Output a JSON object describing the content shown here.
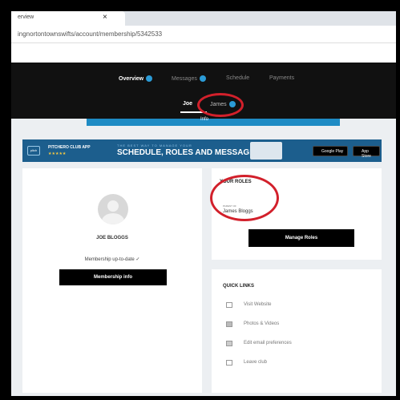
{
  "browser": {
    "tab_title": "erview",
    "tab_close": "×",
    "address": "ingnortontownswifts/account/membership/5342533"
  },
  "nav": {
    "items": [
      {
        "label": "Overview",
        "badge": true,
        "active": true
      },
      {
        "label": "Messages",
        "badge": true,
        "active": false
      },
      {
        "label": "Schedule",
        "badge": false,
        "active": false
      },
      {
        "label": "Payments",
        "badge": false,
        "active": false
      }
    ],
    "sub_tabs": [
      {
        "label": "Joe",
        "active": true
      },
      {
        "label": "James",
        "active": false,
        "badge": true
      }
    ]
  },
  "cta_bar": {
    "label": "Info"
  },
  "banner": {
    "logo_text": "pitch",
    "app_name": "PITCHERO CLUB APP",
    "stars": "★★★★★",
    "tagline": "THE BEST WAY TO MANAGE YOUR",
    "headline": "SCHEDULE, ROLES AND MESSAGES",
    "google_play": "Google Play",
    "app_store": "App Store",
    "colors": {
      "background": "#1c5e8d",
      "star": "#f5c842"
    }
  },
  "profile": {
    "name": "JOE BLOGGS",
    "membership_status": "Membership up-to-date ✓",
    "membership_button": "Membership info"
  },
  "roles": {
    "title": "YOUR ROLES",
    "sublabel": "PARENT OF",
    "person": "James Bloggs",
    "manage_button": "Manage Roles"
  },
  "quick_links": {
    "title": "QUICK LINKS",
    "items": [
      {
        "label": "Visit Website",
        "icon": "monitor-icon"
      },
      {
        "label": "Photos & Videos",
        "icon": "camera-icon"
      },
      {
        "label": "Edit email preferences",
        "icon": "envelope-icon"
      },
      {
        "label": "Leave club",
        "icon": "exit-icon"
      }
    ]
  },
  "annotation_color": "#d2202b"
}
